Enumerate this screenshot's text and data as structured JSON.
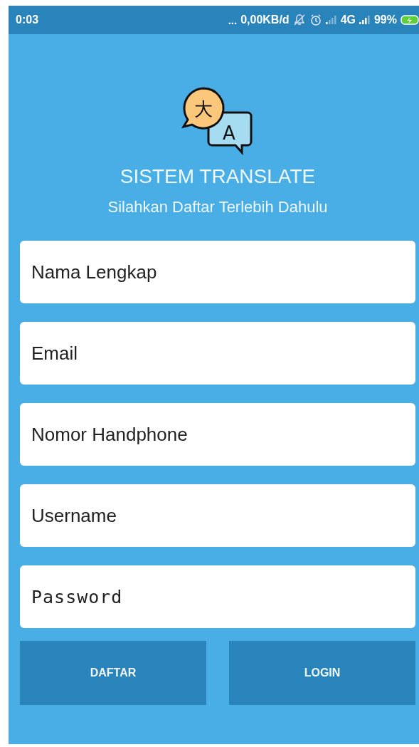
{
  "status_bar": {
    "time": "0:03",
    "dots": "...",
    "network_speed": "0,00KB/d",
    "network_type": "4G",
    "battery": "99%"
  },
  "logo": {
    "glyph_left": "大",
    "glyph_right": "A"
  },
  "title": "SISTEM TRANSLATE",
  "subtitle": "Silahkan Daftar Terlebih Dahulu",
  "fields": [
    {
      "placeholder": "Nama Lengkap",
      "kind": "text"
    },
    {
      "placeholder": "Email",
      "kind": "text"
    },
    {
      "placeholder": "Nomor Handphone",
      "kind": "text"
    },
    {
      "placeholder": "Username",
      "kind": "text"
    },
    {
      "placeholder": "Password",
      "kind": "password"
    }
  ],
  "buttons": [
    "DAFTAR",
    "LOGIN"
  ]
}
